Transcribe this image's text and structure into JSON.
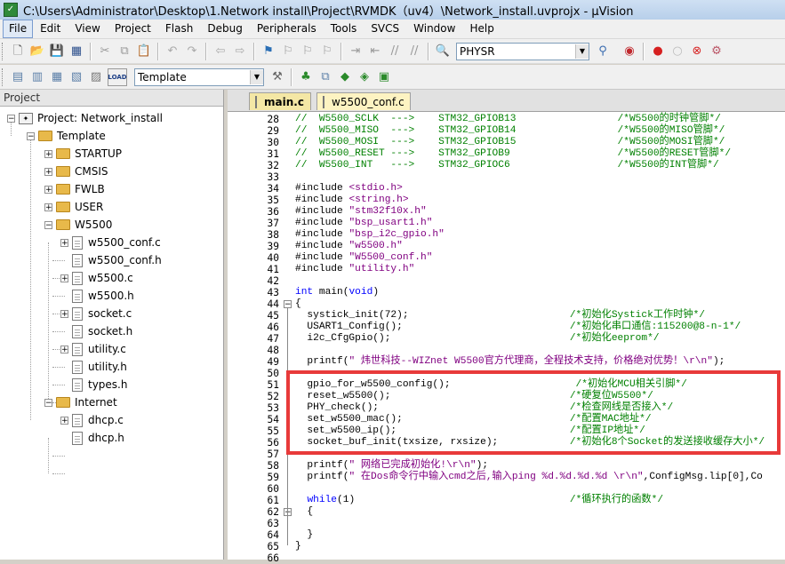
{
  "window": {
    "title": "C:\\Users\\Administrator\\Desktop\\1.Network install\\Project\\RVMDK（uv4）\\Network_install.uvprojx - µVision"
  },
  "menu": [
    "File",
    "Edit",
    "View",
    "Project",
    "Flash",
    "Debug",
    "Peripherals",
    "Tools",
    "SVCS",
    "Window",
    "Help"
  ],
  "toolbar": {
    "find_combo_value": "PHYSR",
    "target_combo_value": "Template",
    "load_label": "LOAD"
  },
  "project_panel": {
    "title": "Project",
    "tree": [
      {
        "label": "Project: Network_install",
        "type": "project",
        "level": 0,
        "expanded": true
      },
      {
        "label": "Template",
        "type": "folder-open",
        "level": 1,
        "expanded": true
      },
      {
        "label": "STARTUP",
        "type": "folder",
        "level": 2,
        "expanded": false
      },
      {
        "label": "CMSIS",
        "type": "folder",
        "level": 2,
        "expanded": false
      },
      {
        "label": "FWLB",
        "type": "folder",
        "level": 2,
        "expanded": false
      },
      {
        "label": "USER",
        "type": "folder",
        "level": 2,
        "expanded": false
      },
      {
        "label": "W5500",
        "type": "folder-open",
        "level": 2,
        "expanded": true
      },
      {
        "label": "w5500_conf.c",
        "type": "file",
        "level": 3,
        "expander": true
      },
      {
        "label": "w5500_conf.h",
        "type": "file",
        "level": 3,
        "expander": false
      },
      {
        "label": "w5500.c",
        "type": "file",
        "level": 3,
        "expander": true
      },
      {
        "label": "w5500.h",
        "type": "file",
        "level": 3,
        "expander": false
      },
      {
        "label": "socket.c",
        "type": "file",
        "level": 3,
        "expander": true
      },
      {
        "label": "socket.h",
        "type": "file",
        "level": 3,
        "expander": false
      },
      {
        "label": "utility.c",
        "type": "file",
        "level": 3,
        "expander": true
      },
      {
        "label": "utility.h",
        "type": "file",
        "level": 3,
        "expander": false
      },
      {
        "label": "types.h",
        "type": "file",
        "level": 3,
        "expander": false
      },
      {
        "label": "Internet",
        "type": "folder-open",
        "level": 2,
        "expanded": true
      },
      {
        "label": "dhcp.c",
        "type": "file",
        "level": 3,
        "expander": true
      },
      {
        "label": "dhcp.h",
        "type": "file",
        "level": 3,
        "expander": false
      }
    ]
  },
  "editor": {
    "tabs": [
      {
        "label": "main.c",
        "active": true
      },
      {
        "label": "w5500_conf.c",
        "active": false
      }
    ],
    "lines": [
      {
        "n": "28",
        "segs": [
          {
            "t": "//  W5500_SCLK  --->    STM32_GPIOB13                 /*W5500的时钟管脚*/",
            "c": "cmt"
          }
        ]
      },
      {
        "n": "29",
        "segs": [
          {
            "t": "//  W5500_MISO  --->    STM32_GPIOB14                 /*W5500的MISO管脚*/",
            "c": "cmt"
          }
        ]
      },
      {
        "n": "30",
        "segs": [
          {
            "t": "//  W5500_MOSI  --->    STM32_GPIOB15                 /*W5500的MOSI管脚*/",
            "c": "cmt"
          }
        ]
      },
      {
        "n": "31",
        "segs": [
          {
            "t": "//  W5500_RESET --->    STM32_GPIOB9                  /*W5500的RESET管脚*/",
            "c": "cmt"
          }
        ]
      },
      {
        "n": "32",
        "segs": [
          {
            "t": "//  W5500_INT   --->    STM32_GPIOC6                  /*W5500的INT管脚*/",
            "c": "cmt"
          }
        ]
      },
      {
        "n": "33",
        "segs": []
      },
      {
        "n": "34",
        "segs": [
          {
            "t": "#include ",
            "c": ""
          },
          {
            "t": "<stdio.h>",
            "c": "str"
          }
        ]
      },
      {
        "n": "35",
        "segs": [
          {
            "t": "#include ",
            "c": ""
          },
          {
            "t": "<string.h>",
            "c": "str"
          }
        ]
      },
      {
        "n": "36",
        "segs": [
          {
            "t": "#include ",
            "c": ""
          },
          {
            "t": "\"stm32f10x.h\"",
            "c": "str"
          }
        ]
      },
      {
        "n": "37",
        "segs": [
          {
            "t": "#include ",
            "c": ""
          },
          {
            "t": "\"bsp_usart1.h\"",
            "c": "str"
          }
        ]
      },
      {
        "n": "38",
        "segs": [
          {
            "t": "#include ",
            "c": ""
          },
          {
            "t": "\"bsp_i2c_gpio.h\"",
            "c": "str"
          }
        ]
      },
      {
        "n": "39",
        "segs": [
          {
            "t": "#include ",
            "c": ""
          },
          {
            "t": "\"w5500.h\"",
            "c": "str"
          }
        ]
      },
      {
        "n": "40",
        "segs": [
          {
            "t": "#include ",
            "c": ""
          },
          {
            "t": "\"W5500_conf.h\"",
            "c": "str"
          }
        ]
      },
      {
        "n": "41",
        "segs": [
          {
            "t": "#include ",
            "c": ""
          },
          {
            "t": "\"utility.h\"",
            "c": "str"
          }
        ]
      },
      {
        "n": "42",
        "segs": []
      },
      {
        "n": "43",
        "segs": [
          {
            "t": "int",
            "c": "kw"
          },
          {
            "t": " main(",
            "c": ""
          },
          {
            "t": "void",
            "c": "kw"
          },
          {
            "t": ")",
            "c": ""
          }
        ]
      },
      {
        "n": "44",
        "segs": [
          {
            "t": "{",
            "c": ""
          }
        ]
      },
      {
        "n": "45",
        "segs": [
          {
            "t": "  systick_init(72);                           ",
            "c": ""
          },
          {
            "t": "/*初始化Systick工作时钟*/",
            "c": "cmt"
          }
        ]
      },
      {
        "n": "46",
        "segs": [
          {
            "t": "  USART1_Config();                            ",
            "c": ""
          },
          {
            "t": "/*初始化串口通信:115200@8-n-1*/",
            "c": "cmt"
          }
        ]
      },
      {
        "n": "47",
        "segs": [
          {
            "t": "  i2c_CfgGpio();                              ",
            "c": ""
          },
          {
            "t": "/*初始化eeprom*/",
            "c": "cmt"
          }
        ]
      },
      {
        "n": "48",
        "segs": []
      },
      {
        "n": "49",
        "segs": [
          {
            "t": "  printf(",
            "c": ""
          },
          {
            "t": "\" 炜世科技--WIZnet W5500官方代理商，全程技术支持，价格绝对优势！\\r\\n\"",
            "c": "str"
          },
          {
            "t": ");",
            "c": ""
          }
        ]
      },
      {
        "n": "50",
        "segs": []
      },
      {
        "n": "51",
        "segs": [
          {
            "t": "  gpio_for_w5500_config();                     ",
            "c": ""
          },
          {
            "t": "/*初始化MCU相关引脚*/",
            "c": "cmt"
          }
        ]
      },
      {
        "n": "52",
        "segs": [
          {
            "t": "  reset_w5500();                              ",
            "c": ""
          },
          {
            "t": "/*硬复位W5500*/",
            "c": "cmt"
          }
        ]
      },
      {
        "n": "53",
        "segs": [
          {
            "t": "  PHY_check();                                ",
            "c": ""
          },
          {
            "t": "/*检查网线是否接入*/",
            "c": "cmt"
          }
        ]
      },
      {
        "n": "54",
        "segs": [
          {
            "t": "  set_w5500_mac();                            ",
            "c": ""
          },
          {
            "t": "/*配置MAC地址*/",
            "c": "cmt"
          }
        ]
      },
      {
        "n": "55",
        "segs": [
          {
            "t": "  set_w5500_ip();                             ",
            "c": ""
          },
          {
            "t": "/*配置IP地址*/",
            "c": "cmt"
          }
        ]
      },
      {
        "n": "56",
        "segs": [
          {
            "t": "  socket_buf_init(txsize, rxsize);            ",
            "c": ""
          },
          {
            "t": "/*初始化8个Socket的发送接收缓存大小*/",
            "c": "cmt"
          }
        ]
      },
      {
        "n": "57",
        "segs": []
      },
      {
        "n": "58",
        "segs": [
          {
            "t": "  printf(",
            "c": ""
          },
          {
            "t": "\" 网络已完成初始化!\\r\\n\"",
            "c": "str"
          },
          {
            "t": ");",
            "c": ""
          }
        ]
      },
      {
        "n": "59",
        "segs": [
          {
            "t": "  printf(",
            "c": ""
          },
          {
            "t": "\" 在Dos命令行中输入cmd之后,输入ping %d.%d.%d.%d \\r\\n\"",
            "c": "str"
          },
          {
            "t": ",ConfigMsg.lip[0],Co",
            "c": ""
          }
        ]
      },
      {
        "n": "60",
        "segs": []
      },
      {
        "n": "61",
        "segs": [
          {
            "t": "  ",
            "c": ""
          },
          {
            "t": "while",
            "c": "kw"
          },
          {
            "t": "(1)                                    ",
            "c": ""
          },
          {
            "t": "/*循环执行的函数*/",
            "c": "cmt"
          }
        ]
      },
      {
        "n": "62",
        "segs": [
          {
            "t": "  {",
            "c": ""
          }
        ]
      },
      {
        "n": "63",
        "segs": []
      },
      {
        "n": "64",
        "segs": [
          {
            "t": "  }",
            "c": ""
          }
        ]
      },
      {
        "n": "65",
        "segs": [
          {
            "t": "}",
            "c": ""
          }
        ]
      },
      {
        "n": "66",
        "segs": []
      }
    ]
  }
}
